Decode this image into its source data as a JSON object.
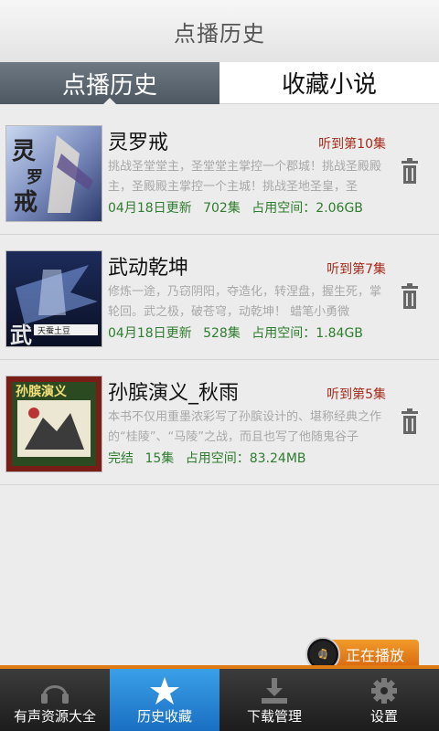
{
  "header": {
    "title": "点播历史"
  },
  "tabs": [
    {
      "label": "点播历史",
      "active": true
    },
    {
      "label": "收藏小说",
      "active": false
    }
  ],
  "items": [
    {
      "title": "灵罗戒",
      "progress": "听到第10集",
      "description": "挑战圣堂堂主，圣堂堂主掌控一个郡城！挑战圣殿殿主，圣殿殿主掌控一个主城！挑战圣地圣皇，圣",
      "updated": "04月18日更新",
      "episodes": "702集",
      "space": "占用空间：2.06GB",
      "cover_text": "灵罗戒"
    },
    {
      "title": "武动乾坤",
      "progress": "听到第7集",
      "description": "修炼一途，乃窃阴阳，夺造化，转涅盘，握生死，掌轮回。武之极，破苍穹，动乾坤！ 蜡笔小勇微",
      "updated": "04月18日更新",
      "episodes": "528集",
      "space": "占用空间：1.84GB",
      "cover_text": "武动乾坤"
    },
    {
      "title": "孙膑演义_秋雨",
      "progress": "听到第5集",
      "description": "本书不仅用重墨浓彩写了孙膑设计的、堪称经典之作的“桂陵”、“马陵”之战，而且也写了他随鬼谷子",
      "updated": "完结",
      "episodes": "15集",
      "space": "占用空间：83.24MB",
      "cover_text": "孙膑演义"
    }
  ],
  "now_playing": {
    "label": "正在播放"
  },
  "bottom_nav": [
    {
      "label": "有声资源大全",
      "icon": "headphones-icon",
      "active": false
    },
    {
      "label": "历史收藏",
      "icon": "star-icon",
      "active": true
    },
    {
      "label": "下载管理",
      "icon": "download-icon",
      "active": false
    },
    {
      "label": "设置",
      "icon": "gear-icon",
      "active": false
    }
  ],
  "colors": {
    "progress_text": "#a52a1a",
    "meta_text": "#2e7d2e",
    "accent_orange": "#e07a12",
    "nav_active": "#2a88d8"
  }
}
